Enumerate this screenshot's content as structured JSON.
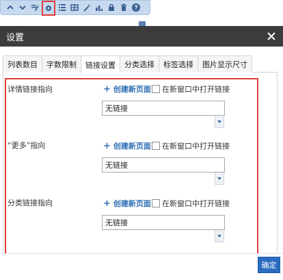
{
  "toolbar": {
    "icons": [
      "chevron-up-icon",
      "chevron-down-icon",
      "edit-icon",
      "settings-icon",
      "list-icon",
      "columns-icon",
      "magic-wand-icon",
      "chart-icon",
      "lock-icon",
      "trash-icon",
      "help-icon"
    ],
    "help_label": "?"
  },
  "dialog": {
    "title": "设置",
    "close_icon": "close-icon",
    "tabs": [
      {
        "label": "列表数目",
        "active": false
      },
      {
        "label": "字数限制",
        "active": false
      },
      {
        "label": "链接设置",
        "active": true
      },
      {
        "label": "分类选择",
        "active": false
      },
      {
        "label": "标签选择",
        "active": false
      },
      {
        "label": "图片显示尺寸",
        "active": false
      }
    ],
    "rows": [
      {
        "label": "详情链接指向",
        "create_label": "创建新页面",
        "new_window_label": "在新窗口中打开链接",
        "select_value": "无链接"
      },
      {
        "label": "“更多”指向",
        "create_label": "创建新页面",
        "new_window_label": "在新窗口中打开链接",
        "select_value": "无链接"
      },
      {
        "label": "分类链接指向",
        "create_label": "创建新页面",
        "new_window_label": "在新窗口中打开链接",
        "select_value": "无链接"
      }
    ],
    "confirm_label": "确定"
  },
  "colors": {
    "header_bg": "#3c3c3c",
    "accent_link": "#2f6fb5",
    "confirm_bg": "#2a6cc0",
    "highlight": "#e13b3b",
    "toolbar_bg": "#c6d9ef"
  }
}
